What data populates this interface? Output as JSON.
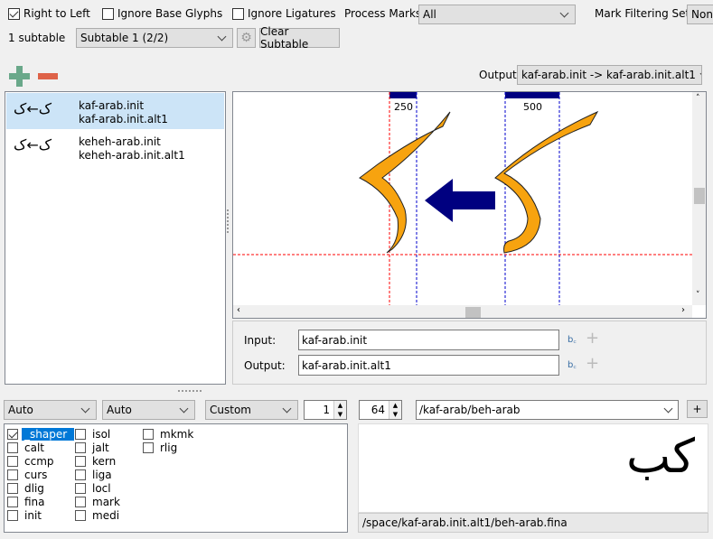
{
  "toolbar": {
    "right_to_left": {
      "label": "Right to Left",
      "checked": true
    },
    "ignore_base": {
      "label": "Ignore Base Glyphs",
      "checked": false
    },
    "ignore_lig": {
      "label": "Ignore Ligatures",
      "checked": false
    },
    "process_marks_label": "Process Marks:",
    "process_marks_value": "All",
    "mark_filter_label": "Mark Filtering Set:",
    "mark_filter_value": "Non",
    "subtable_count": "1 subtable",
    "subtable_value": "Subtable 1 (2/2)",
    "clear_subtable": "Clear Subtable",
    "output_label": "Output:",
    "output_value": "kaf-arab.init -> kaf-arab.init.alt1"
  },
  "rules": [
    {
      "input": "kaf-arab.init",
      "output": "kaf-arab.init.alt1",
      "selected": true
    },
    {
      "input": "keheh-arab.init",
      "output": "keheh-arab.init.alt1",
      "selected": false
    }
  ],
  "canvas": {
    "marker1": "250",
    "marker2": "500",
    "colors": {
      "glyph": "#f7a30f",
      "arrow": "#000080",
      "baseline": "#ff0000",
      "advance": "#0000cc"
    }
  },
  "io": {
    "input_label": "Input:",
    "input_value": "kaf-arab.init",
    "output_label": "Output:",
    "output_value": "kaf-arab.init.alt1"
  },
  "bottom": {
    "script": "Auto",
    "language": "Auto",
    "direction": "Custom",
    "spin1": "1",
    "size": "64",
    "text": "/kaf-arab/beh-arab",
    "add": "+",
    "preview_text": "كب",
    "status": "/space/kaf-arab.init.alt1/beh-arab.fina"
  },
  "features": [
    {
      "tag": "_shaper",
      "checked": true,
      "selected": true
    },
    {
      "tag": "calt"
    },
    {
      "tag": "ccmp"
    },
    {
      "tag": "curs"
    },
    {
      "tag": "dlig"
    },
    {
      "tag": "fina"
    },
    {
      "tag": "init"
    },
    {
      "tag": "isol"
    },
    {
      "tag": "jalt"
    },
    {
      "tag": "kern"
    },
    {
      "tag": "liga"
    },
    {
      "tag": "locl"
    },
    {
      "tag": "mark"
    },
    {
      "tag": "medi"
    },
    {
      "tag": "mkmk"
    },
    {
      "tag": "rlig"
    }
  ]
}
